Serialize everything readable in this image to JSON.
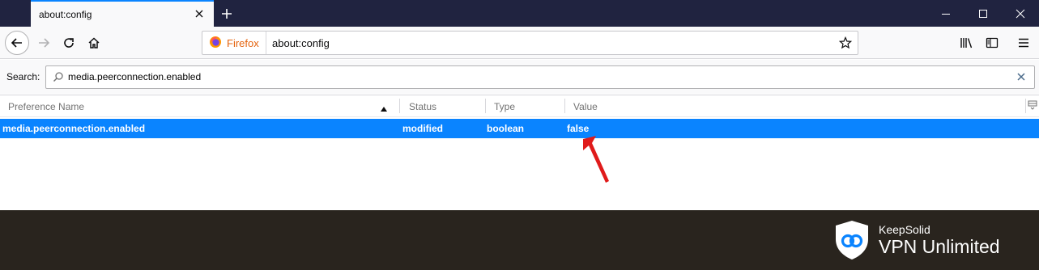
{
  "tab": {
    "title": "about:config"
  },
  "urlbar": {
    "identity_label": "Firefox",
    "url": "about:config"
  },
  "search": {
    "label": "Search:",
    "value": "media.peerconnection.enabled"
  },
  "table": {
    "columns": [
      "Preference Name",
      "Status",
      "Type",
      "Value"
    ],
    "rows": [
      {
        "name": "media.peerconnection.enabled",
        "status": "modified",
        "type": "boolean",
        "value": "false"
      }
    ]
  },
  "brand": {
    "company": "KeepSolid",
    "product": "VPN Unlimited"
  },
  "colors": {
    "accent": "#0a84ff",
    "titlebar": "#202340",
    "banner": "#29241e",
    "annotation": "#e01b1b"
  },
  "icons": [
    "close-icon",
    "plus-icon",
    "minimize-icon",
    "maximize-icon",
    "back-icon",
    "forward-icon",
    "reload-icon",
    "home-icon",
    "firefox-logo-icon",
    "bookmark-star-icon",
    "library-icon",
    "sidebar-icon",
    "menu-icon",
    "search-icon",
    "clear-icon",
    "sort-ascending-icon",
    "column-picker-icon",
    "shield-logo-icon",
    "arrow-annotation-icon"
  ]
}
